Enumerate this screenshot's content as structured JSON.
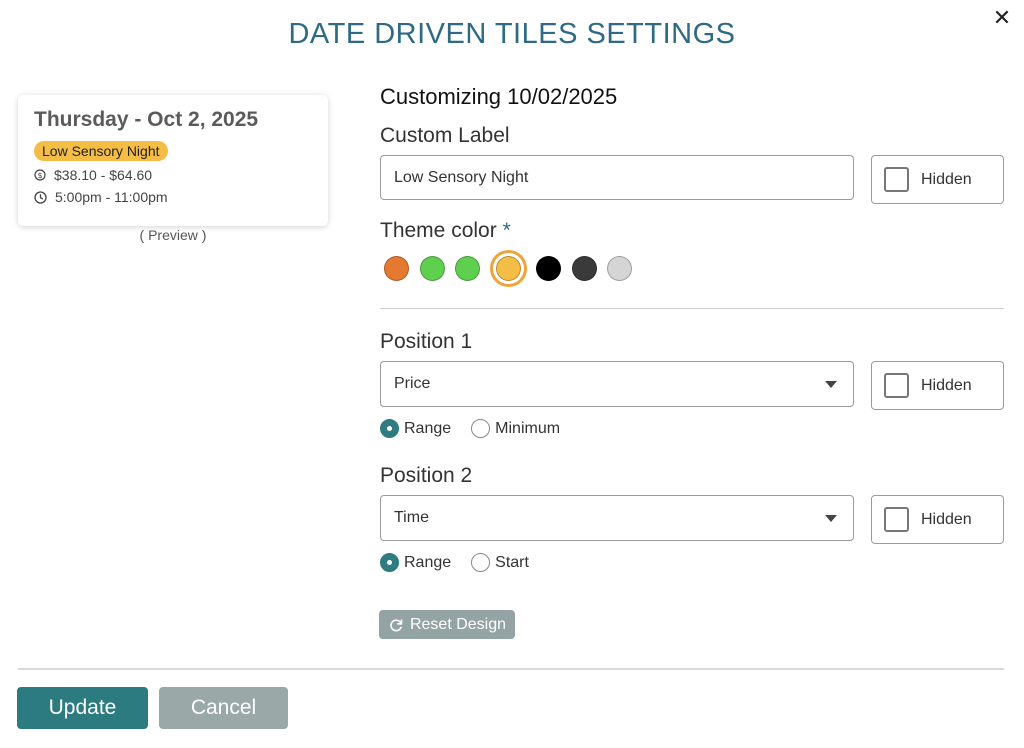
{
  "dialog": {
    "title": "DATE DRIVEN TILES SETTINGS",
    "close_icon": "close-icon"
  },
  "preview": {
    "date": "Thursday - Oct 2, 2025",
    "badge": "Low Sensory Night",
    "badge_color": "#f4bd46",
    "price": "$38.10 - $64.60",
    "time": "5:00pm - 11:00pm",
    "caption": "( Preview )"
  },
  "form": {
    "customizing": "Customizing 10/02/2025",
    "custom_label": {
      "label": "Custom Label",
      "value": "Low Sensory Night",
      "hidden_label": "Hidden"
    },
    "theme": {
      "label": "Theme color",
      "required_mark": "*",
      "swatches": [
        "#e5792f",
        "#5fcf4f",
        "#5fcf4f",
        "#f4bd46",
        "#000000",
        "#3a3a3a",
        "#d5d5d5"
      ],
      "selected_index": 3
    },
    "position1": {
      "label": "Position 1",
      "value": "Price",
      "hidden_label": "Hidden",
      "options": [
        "Range",
        "Minimum"
      ],
      "selected": "Range"
    },
    "position2": {
      "label": "Position 2",
      "value": "Time",
      "hidden_label": "Hidden",
      "options": [
        "Range",
        "Start"
      ],
      "selected": "Range"
    },
    "reset_label": "Reset Design"
  },
  "footer": {
    "update_label": "Update",
    "cancel_label": "Cancel"
  },
  "colors": {
    "title": "#2e6a85",
    "primary": "#2c7b80",
    "secondary": "#9aa8a8"
  }
}
